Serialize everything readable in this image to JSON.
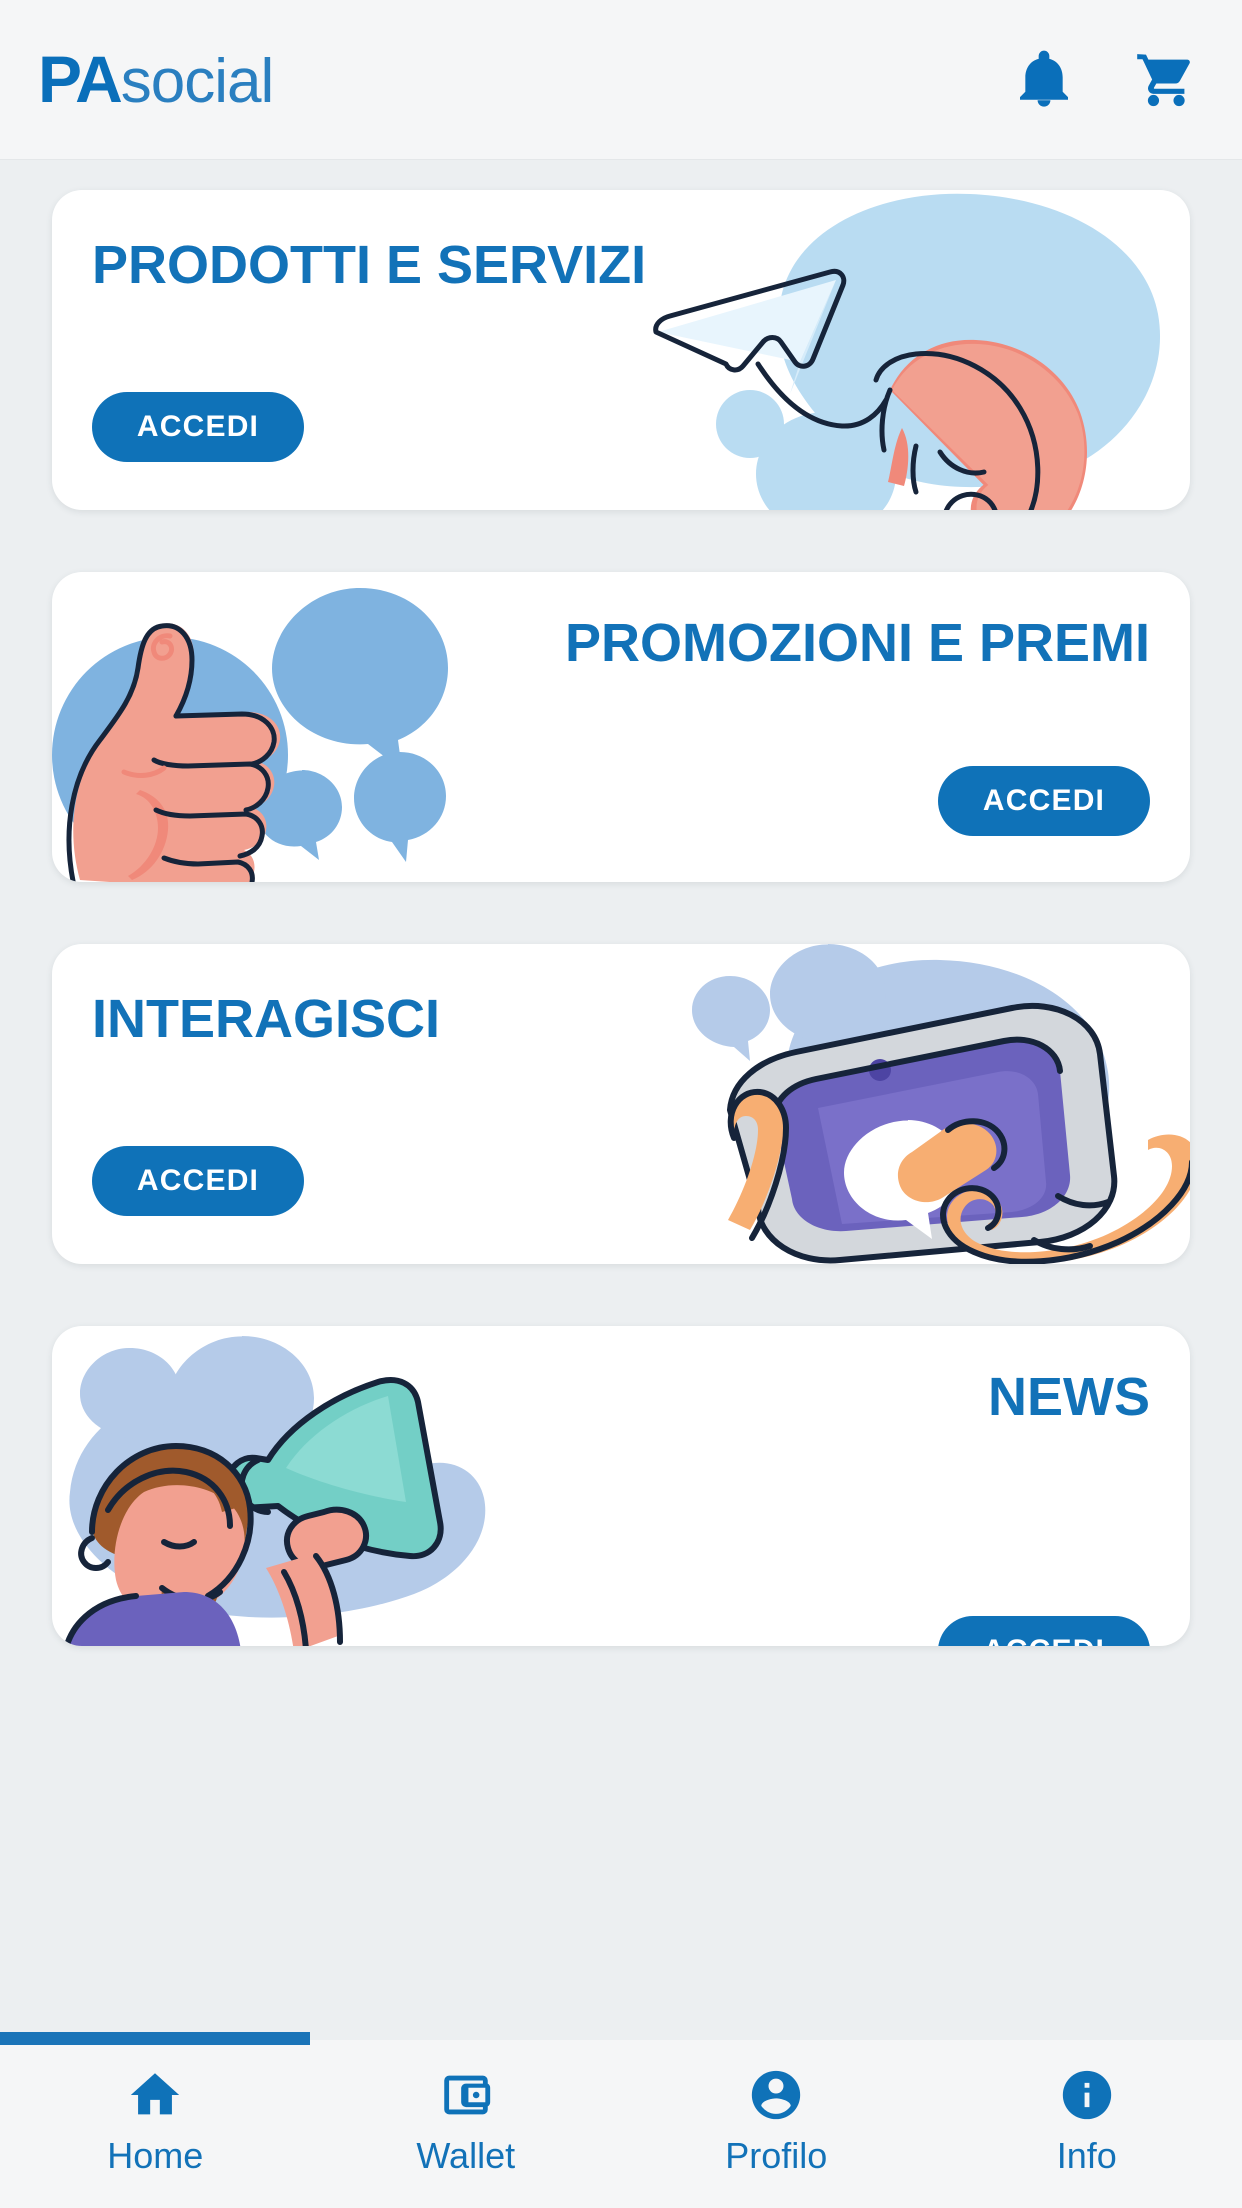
{
  "header": {
    "brand_pa": "PA",
    "brand_social": "social",
    "notifications_icon": "bell-icon",
    "cart_icon": "shopping-cart-icon",
    "background": "#f5f6f7"
  },
  "theme": {
    "accent_blue": "#1272b8",
    "button_blue": "#0f72b8",
    "page_background": "#eceff1",
    "card_background": "#ffffff",
    "illustration_light_blue": "#b9dcf2",
    "illustration_mid_blue": "#7fb3e0",
    "illustration_periwinkle": "#b5cbe9",
    "skin_pink": "#f2a090",
    "skin_orange": "#f7ae72",
    "tablet_purple": "#6b62bd",
    "megaphone_teal": "#73cfc6",
    "ink": "#152a3a"
  },
  "cards": [
    {
      "id": "prodotti-e-servizi",
      "title": "PRODOTTI E SERVIZI",
      "title_align": "left",
      "button_label": "ACCEDI",
      "button_align": "left",
      "illustration": "paper-plane-hand-illustration"
    },
    {
      "id": "promozioni-e-premi",
      "title": "PROMOZIONI E PREMI",
      "title_align": "right",
      "button_label": "ACCEDI",
      "button_align": "right",
      "illustration": "thumbs-up-speech-bubbles-illustration"
    },
    {
      "id": "interagisci",
      "title": "INTERAGISCI",
      "title_align": "left",
      "button_label": "ACCEDI",
      "button_align": "left",
      "illustration": "hands-tablet-chat-illustration"
    },
    {
      "id": "news",
      "title": "NEWS",
      "title_align": "right",
      "button_label": "ACCEDI",
      "button_align": "right",
      "illustration": "man-megaphone-illustration"
    }
  ],
  "bottom_nav": {
    "active_item": "Home",
    "items": [
      {
        "label": "Home",
        "icon": "home-icon"
      },
      {
        "label": "Wallet",
        "icon": "wallet-icon"
      },
      {
        "label": "Profilo",
        "icon": "account-circle-icon"
      },
      {
        "label": "Info",
        "icon": "info-circle-icon"
      }
    ]
  }
}
